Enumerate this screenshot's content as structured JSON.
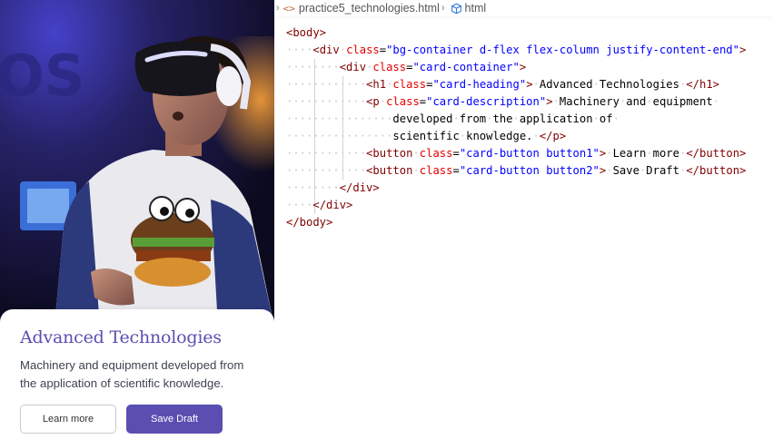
{
  "preview": {
    "card_heading": "Advanced Technologies",
    "card_description": "Machinery and equipment developed from the application of scientific knowledge.",
    "button1_label": "Learn more",
    "button2_label": "Save Draft",
    "accent_color": "#5a4fb0"
  },
  "editor": {
    "breadcrumb": {
      "file_name": "practice5_technologies.html",
      "symbol": "html",
      "file_icon": "code-brackets-icon",
      "symbol_icon": "cube-icon"
    },
    "code_lines": [
      {
        "indent": "",
        "parts": [
          [
            "tag",
            "<body>"
          ]
        ]
      },
      {
        "indent": "····",
        "parts": [
          [
            "tag",
            "<div"
          ],
          [
            "txt",
            " "
          ],
          [
            "attr",
            "class"
          ],
          [
            "txt",
            "="
          ],
          [
            "str",
            "\"bg-container d-flex flex-column justify-content-end\""
          ],
          [
            "tag",
            ">"
          ]
        ]
      },
      {
        "indent": "········",
        "parts": [
          [
            "tag",
            "<div"
          ],
          [
            "txt",
            " "
          ],
          [
            "attr",
            "class"
          ],
          [
            "txt",
            "="
          ],
          [
            "str",
            "\"card-container\""
          ],
          [
            "tag",
            ">"
          ]
        ]
      },
      {
        "indent": "············",
        "parts": [
          [
            "tag",
            "<h1"
          ],
          [
            "txt",
            " "
          ],
          [
            "attr",
            "class"
          ],
          [
            "txt",
            "="
          ],
          [
            "str",
            "\"card-heading\""
          ],
          [
            "tag",
            ">"
          ],
          [
            "txt",
            " Advanced Technologies "
          ],
          [
            "tag",
            "</h1>"
          ]
        ]
      },
      {
        "indent": "············",
        "parts": [
          [
            "tag",
            "<p"
          ],
          [
            "txt",
            " "
          ],
          [
            "attr",
            "class"
          ],
          [
            "txt",
            "="
          ],
          [
            "str",
            "\"card-description\""
          ],
          [
            "tag",
            ">"
          ],
          [
            "txt",
            " Machinery and equipment "
          ]
        ]
      },
      {
        "indent": "················",
        "parts": [
          [
            "txt",
            "developed from the application of "
          ]
        ]
      },
      {
        "indent": "················",
        "parts": [
          [
            "txt",
            "scientific knowledge. "
          ],
          [
            "tag",
            "</p>"
          ]
        ]
      },
      {
        "indent": "············",
        "parts": [
          [
            "tag",
            "<button"
          ],
          [
            "txt",
            " "
          ],
          [
            "attr",
            "class"
          ],
          [
            "txt",
            "="
          ],
          [
            "str",
            "\"card-button button1\""
          ],
          [
            "tag",
            ">"
          ],
          [
            "txt",
            " Learn more "
          ],
          [
            "tag",
            "</button>"
          ]
        ]
      },
      {
        "indent": "············",
        "parts": [
          [
            "tag",
            "<button"
          ],
          [
            "txt",
            " "
          ],
          [
            "attr",
            "class"
          ],
          [
            "txt",
            "="
          ],
          [
            "str",
            "\"card-button button2\""
          ],
          [
            "tag",
            ">"
          ],
          [
            "txt",
            " Save Draft "
          ],
          [
            "tag",
            "</button>"
          ]
        ]
      },
      {
        "indent": "········",
        "parts": [
          [
            "tag",
            "</div>"
          ]
        ]
      },
      {
        "indent": "····",
        "parts": [
          [
            "tag",
            "</div>"
          ]
        ]
      },
      {
        "indent": "",
        "parts": [
          [
            "tag",
            "</body>"
          ]
        ]
      }
    ]
  }
}
